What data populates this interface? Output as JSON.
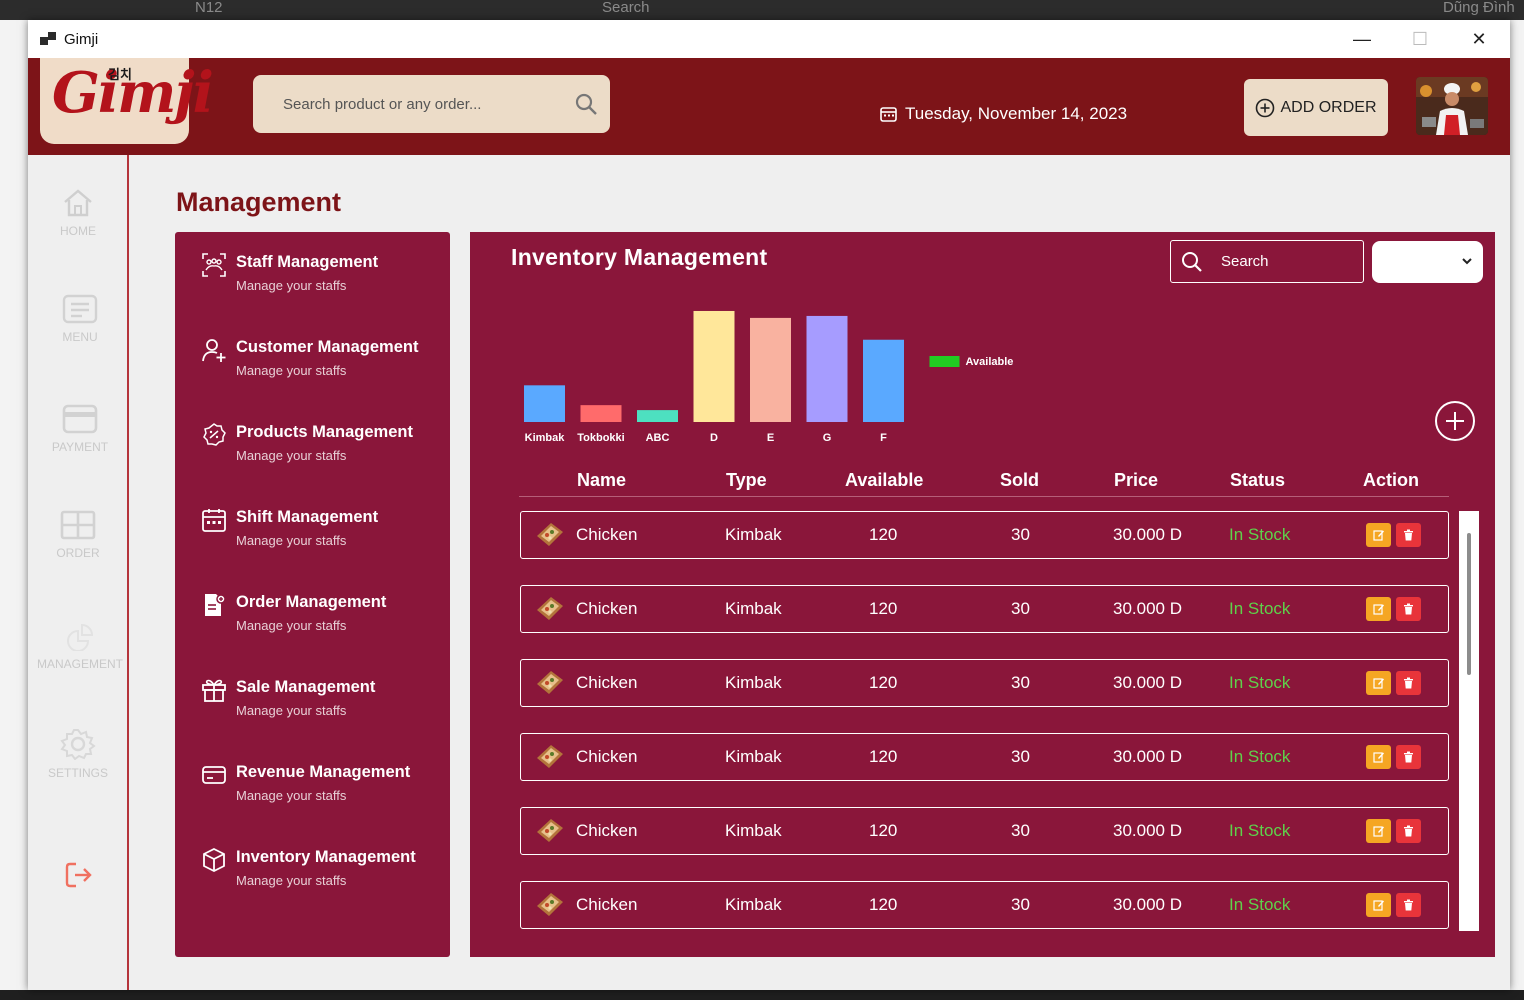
{
  "background": {
    "toolbar_cell": "N12",
    "search_label": "Search",
    "user_name": "Dũng Đình"
  },
  "window": {
    "title": "Gimji",
    "minimize_glyph": "—",
    "maximize_glyph": "☐",
    "close_glyph": "✕"
  },
  "header": {
    "logo_text": "Gimji",
    "logo_korean": "김치",
    "search_placeholder": "Search product or any order...",
    "date": "Tuesday, November 14, 2023",
    "add_order_label": "ADD ORDER"
  },
  "sidebar": {
    "items": [
      {
        "label": "HOME",
        "icon": "home-icon"
      },
      {
        "label": "MENU",
        "icon": "menu-icon"
      },
      {
        "label": "PAYMENT",
        "icon": "card-icon"
      },
      {
        "label": "ORDER",
        "icon": "grid-icon"
      },
      {
        "label": "MANAGEMENT",
        "icon": "chart-pie-icon"
      },
      {
        "label": "SETTINGS",
        "icon": "gear-icon"
      }
    ]
  },
  "page": {
    "title": "Management"
  },
  "management": {
    "items": [
      {
        "title": "Staff Management",
        "subtitle": "Manage your staffs",
        "icon": "staff-icon"
      },
      {
        "title": "Customer Management",
        "subtitle": "Manage your staffs",
        "icon": "user-add-icon"
      },
      {
        "title": "Products Management",
        "subtitle": "Manage your staffs",
        "icon": "badge-icon"
      },
      {
        "title": "Shift Management",
        "subtitle": "Manage your staffs",
        "icon": "calendar-icon"
      },
      {
        "title": "Order Management",
        "subtitle": "Manage your staffs",
        "icon": "document-icon"
      },
      {
        "title": "Sale Management",
        "subtitle": "Manage your staffs",
        "icon": "gift-icon"
      },
      {
        "title": "Revenue Management",
        "subtitle": "Manage your staffs",
        "icon": "wallet-icon"
      },
      {
        "title": "Inventory Management",
        "subtitle": "Manage your staffs",
        "icon": "box-icon"
      }
    ]
  },
  "inventory": {
    "title": "Inventory Management",
    "search_placeholder": "Search",
    "select_value": "",
    "columns": [
      "Name",
      "Type",
      "Available",
      "Sold",
      "Price",
      "Status",
      "Action"
    ],
    "rows": [
      {
        "name": "Chicken",
        "type": "Kimbak",
        "available": "120",
        "sold": "30",
        "price": "30.000 D",
        "status": "In Stock"
      },
      {
        "name": "Chicken",
        "type": "Kimbak",
        "available": "120",
        "sold": "30",
        "price": "30.000 D",
        "status": "In Stock"
      },
      {
        "name": "Chicken",
        "type": "Kimbak",
        "available": "120",
        "sold": "30",
        "price": "30.000 D",
        "status": "In Stock"
      },
      {
        "name": "Chicken",
        "type": "Kimbak",
        "available": "120",
        "sold": "30",
        "price": "30.000 D",
        "status": "In Stock"
      },
      {
        "name": "Chicken",
        "type": "Kimbak",
        "available": "120",
        "sold": "30",
        "price": "30.000 D",
        "status": "In Stock"
      },
      {
        "name": "Chicken",
        "type": "Kimbak",
        "available": "120",
        "sold": "30",
        "price": "30.000 D",
        "status": "In Stock"
      }
    ]
  },
  "chart_data": {
    "type": "bar",
    "categories": [
      "Kimbak",
      "Tokbokki",
      "ABC",
      "D",
      "E",
      "G",
      "F"
    ],
    "series": [
      {
        "name": "Available",
        "values": [
          37,
          17,
          12,
          112,
          105,
          107,
          83
        ]
      }
    ],
    "bar_colors": [
      "#5aa9ff",
      "#ff6b6b",
      "#4de0c0",
      "#ffe79a",
      "#f9b2a0",
      "#a69cff",
      "#5aa9ff"
    ],
    "legend_color": "#22cc22",
    "legend_position": "right",
    "ylim": [
      0,
      115
    ],
    "grid": false
  },
  "colors": {
    "header": "#7d1418",
    "panel": "#8a163a",
    "accent_beige": "#ecdcc8",
    "status_green": "#5ed24a",
    "edit": "#f5a623",
    "delete": "#e8343a"
  }
}
